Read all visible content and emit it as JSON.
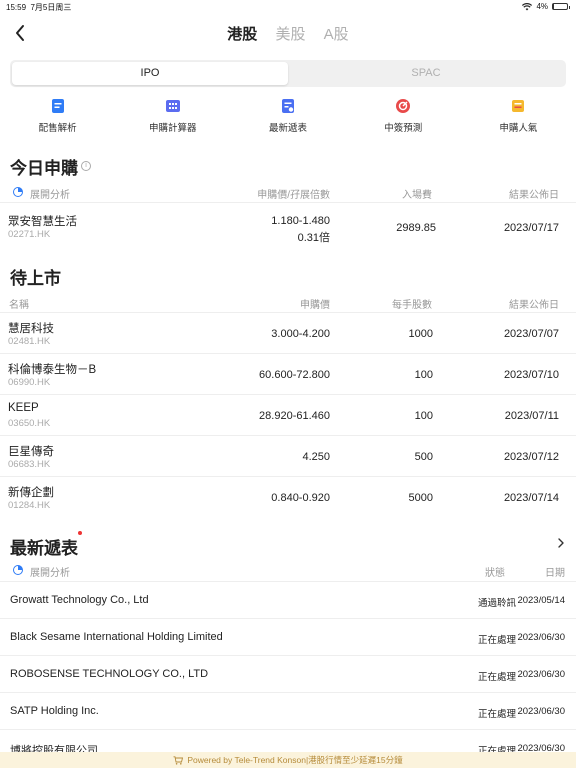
{
  "status": {
    "time": "15:59",
    "date": "7月5日周三",
    "battery": "4%",
    "battery_level": 0.04
  },
  "nav": {
    "markets": [
      "港股",
      "美股",
      "A股"
    ],
    "active_market": 0
  },
  "segments": {
    "ipo": "IPO",
    "spac": "SPAC"
  },
  "tools": [
    {
      "icon": "allotment-analysis-icon",
      "label": "配售解析",
      "color": "#2f7cf6"
    },
    {
      "icon": "subscription-calculator-icon",
      "label": "申購計算器",
      "color": "#5b6cf0"
    },
    {
      "icon": "latest-filings-icon",
      "label": "最新遞表",
      "color": "#4a6ff2"
    },
    {
      "icon": "lottery-prediction-icon",
      "label": "中簽預測",
      "color": "#e84a4a"
    },
    {
      "icon": "subscription-popularity-icon",
      "label": "申購人氣",
      "color": "#f5b82e"
    }
  ],
  "today": {
    "title": "今日申購",
    "expand": "展開分析",
    "headers": {
      "price": "申購價/孖展倍數",
      "fee": "入場費",
      "result": "結果公佈日"
    },
    "rows": [
      {
        "name": "眾安智慧生活",
        "code": "02271.HK",
        "price": "1.180-1.480",
        "margin": "0.31倍",
        "fee": "2989.85",
        "result": "2023/07/17"
      }
    ]
  },
  "upcoming": {
    "title": "待上市",
    "headers": {
      "name": "名稱",
      "price": "申購價",
      "lot": "每手股數",
      "result": "結果公佈日"
    },
    "rows": [
      {
        "name": "慧居科技",
        "code": "02481.HK",
        "price": "3.000-4.200",
        "lot": "1000",
        "result": "2023/07/07"
      },
      {
        "name": "科倫博泰生物－B",
        "code": "06990.HK",
        "price": "60.600-72.800",
        "lot": "100",
        "result": "2023/07/10"
      },
      {
        "name": "KEEP",
        "code": "03650.HK",
        "price": "28.920-61.460",
        "lot": "100",
        "result": "2023/07/11"
      },
      {
        "name": "巨星傳奇",
        "code": "06683.HK",
        "price": "4.250",
        "lot": "500",
        "result": "2023/07/12"
      },
      {
        "name": "新傳企劃",
        "code": "01284.HK",
        "price": "0.840-0.920",
        "lot": "5000",
        "result": "2023/07/14"
      }
    ]
  },
  "filings": {
    "title": "最新遞表",
    "expand": "展開分析",
    "headers": {
      "status": "狀態",
      "date": "日期"
    },
    "rows": [
      {
        "name": "Growatt Technology Co., Ltd",
        "status": "通過聆訊",
        "date": "2023/05/14"
      },
      {
        "name": "Black Sesame International Holding Limited",
        "status": "正在處理",
        "date": "2023/06/30"
      },
      {
        "name": "ROBOSENSE TECHNOLOGY CO., LTD",
        "status": "正在處理",
        "date": "2023/06/30"
      },
      {
        "name": "SATP Holding Inc.",
        "status": "正在處理",
        "date": "2023/06/30"
      },
      {
        "name": "博將控股有限公司",
        "status": "正在處理",
        "date": "2023/06/30"
      }
    ]
  },
  "footer": {
    "text": "Powered by Tele-Trend Konson|港股行情至少延遲15分鐘"
  }
}
